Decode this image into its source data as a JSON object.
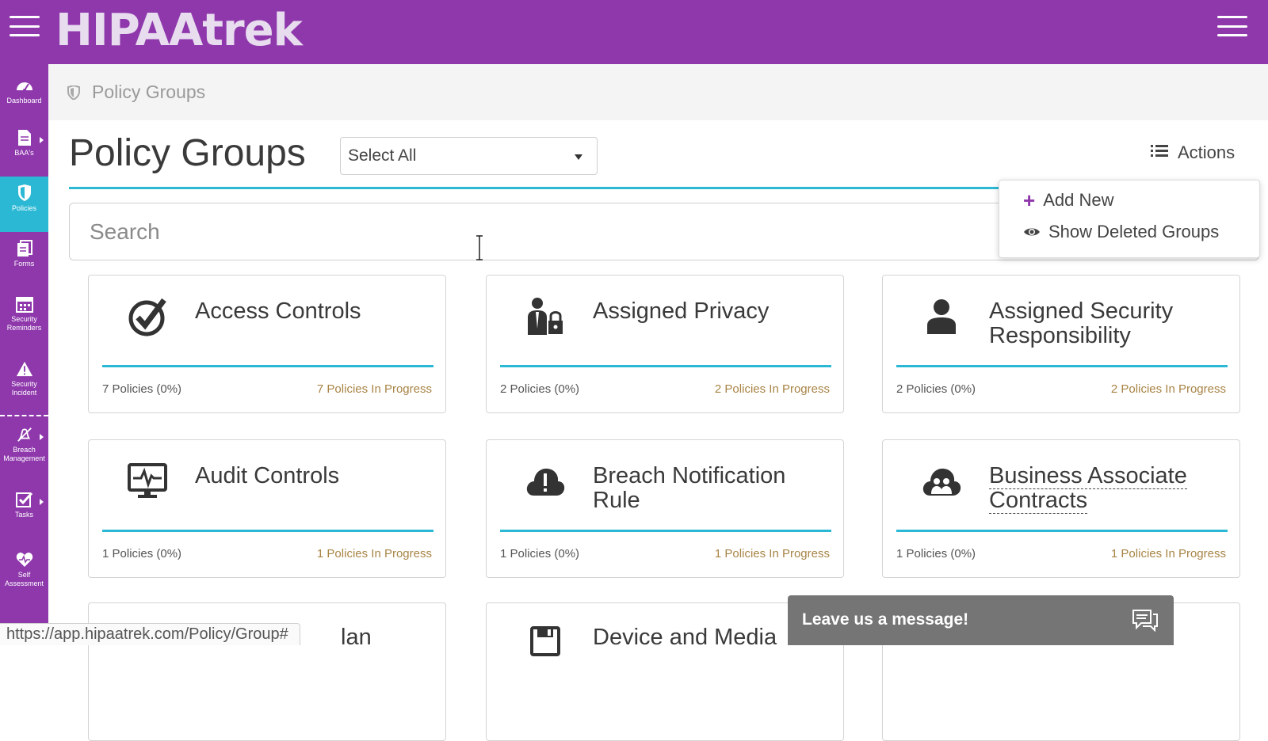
{
  "app": {
    "logo_text": "HIPAAtrek"
  },
  "sidebar": {
    "items": [
      {
        "label": "Dashboard",
        "icon": "gauge-icon"
      },
      {
        "label": "BAA's",
        "icon": "document-icon"
      },
      {
        "label": "Policies",
        "icon": "shield-icon"
      },
      {
        "label": "Forms",
        "icon": "forms-icon"
      },
      {
        "label": "Security\nReminders",
        "icon": "calendar-icon"
      },
      {
        "label": "Security\nIncident",
        "icon": "warning-icon"
      },
      {
        "label": "Breach\nManagement",
        "icon": "bell-slash-icon"
      },
      {
        "label": "Tasks",
        "icon": "checkbox-icon"
      },
      {
        "label": "Self\nAssessment",
        "icon": "heart-pulse-icon"
      }
    ],
    "active": "Policies"
  },
  "breadcrumb": {
    "label": "Policy Groups"
  },
  "page": {
    "title": "Policy Groups",
    "filter_value": "Select All",
    "actions_label": "Actions"
  },
  "search": {
    "placeholder": "Search"
  },
  "actions_menu": {
    "items": [
      {
        "label": "Add New",
        "icon": "plus-icon"
      },
      {
        "label": "Show Deleted Groups",
        "icon": "eye-icon"
      }
    ]
  },
  "cards": [
    {
      "title": "Access Controls",
      "count": "7 Policies (0%)",
      "progress": "7 Policies In Progress",
      "icon": "check-circle-icon"
    },
    {
      "title": "Assigned Privacy",
      "count": "2 Policies (0%)",
      "progress": "2 Policies In Progress",
      "icon": "user-lock-icon"
    },
    {
      "title": "Assigned Security Responsibility",
      "count": "2 Policies (0%)",
      "progress": "2 Policies In Progress",
      "icon": "user-icon"
    },
    {
      "title": "Audit Controls",
      "count": "1 Policies (0%)",
      "progress": "1 Policies In Progress",
      "icon": "monitor-pulse-icon"
    },
    {
      "title": "Breach Notification Rule",
      "count": "1 Policies (0%)",
      "progress": "1 Policies In Progress",
      "icon": "cloud-alert-icon"
    },
    {
      "title": "Business Associate Contracts",
      "count": "1 Policies (0%)",
      "progress": "1 Policies In Progress",
      "icon": "cloud-users-icon"
    },
    {
      "title": "lan",
      "icon": ""
    },
    {
      "title": "Device and Media",
      "icon": "floppy-icon"
    }
  ],
  "status_url": "https://app.hipaatrek.com/Policy/Group#",
  "chat": {
    "label": "Leave us a message!",
    "icon": "chat-icon"
  },
  "colors": {
    "brand_purple": "#8e38ac",
    "accent_teal": "#2bb8d4",
    "progress_gold": "#a88445"
  }
}
